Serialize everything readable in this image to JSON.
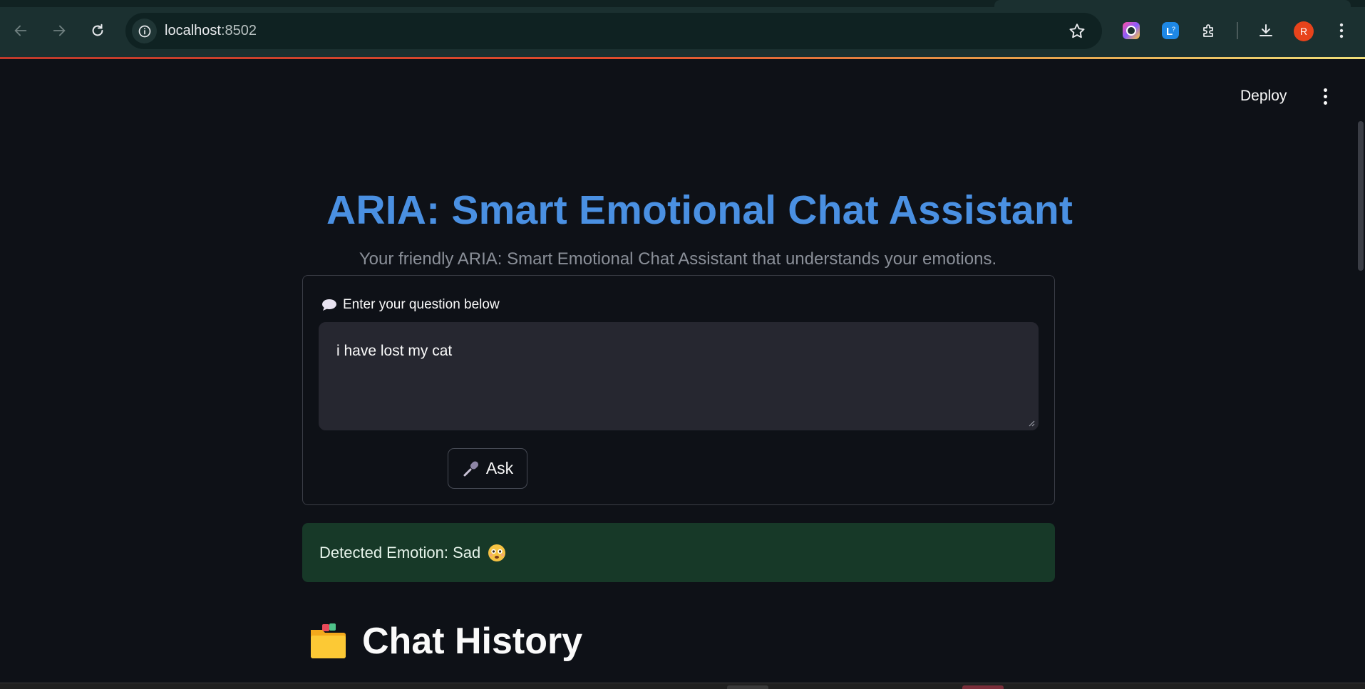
{
  "browser": {
    "url_host": "localhost",
    "url_port": ":8502",
    "avatar_letter": "R"
  },
  "app_header": {
    "deploy_label": "Deploy"
  },
  "main": {
    "title": "ARIA: Smart Emotional Chat Assistant",
    "subtitle": "Your friendly ARIA: Smart Emotional Chat Assistant that understands your emotions.",
    "question_label": "Enter your question below",
    "question_value": "i have lost my cat",
    "ask_label": "Ask",
    "emotion_text": "Detected Emotion: Sad",
    "history_title": "Chat History"
  },
  "icons": {
    "title_icon": "robot-icon",
    "label_icon": "speech-bubble-icon",
    "ask_icon": "microphone-icon",
    "emotion_icon": "sad-face-icon",
    "history_icon": "folder-icon"
  },
  "colors": {
    "title_blue": "#4a90e2",
    "success_bg": "#173928",
    "page_bg": "#0e1117",
    "input_bg": "#262730"
  }
}
